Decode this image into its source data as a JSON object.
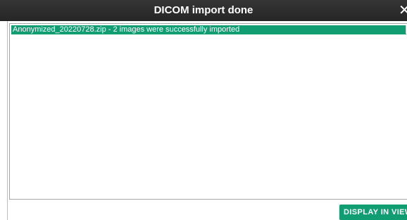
{
  "dialog": {
    "title": "DICOM import done",
    "close_glyph": "✕",
    "close_icon": "close-icon"
  },
  "results": {
    "items": [
      {
        "label": "Anonymized_20220728.zip - 2 images were successfully imported",
        "selected": true
      }
    ]
  },
  "actions": {
    "display_in_viewer_label": "DISPLAY IN VIEWER"
  },
  "colors": {
    "titlebar": "#2e2e2e",
    "accent": "#0f9d71",
    "text_on_accent": "#ffffff"
  }
}
